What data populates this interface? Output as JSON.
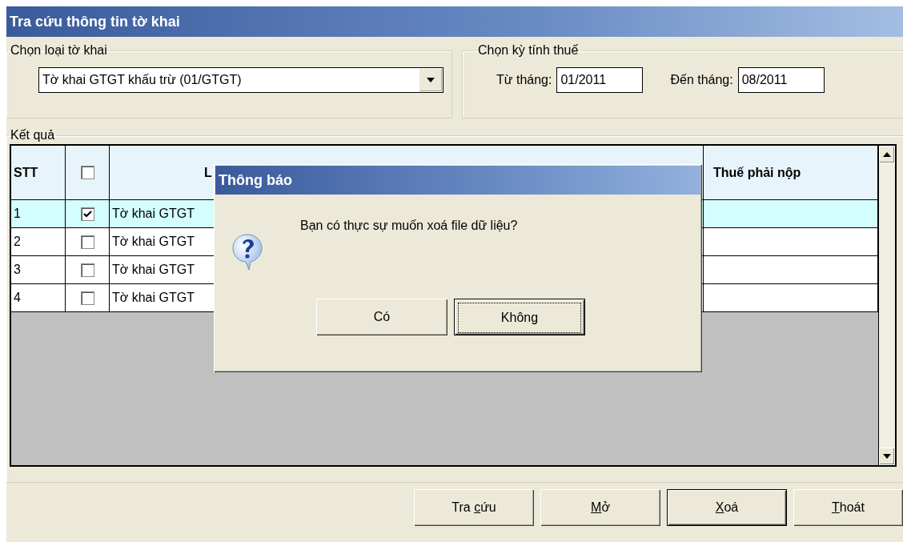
{
  "window": {
    "title": "Tra cứu thông tin tờ khai"
  },
  "declaration_type": {
    "legend": "Chọn loại tờ khai",
    "value": "Tờ khai GTGT khấu trừ (01/GTGT)"
  },
  "tax_period": {
    "legend": "Chọn kỳ tính thuế",
    "from_label": "Từ tháng:",
    "from_value": "01/2011",
    "to_label": "Đến tháng:",
    "to_value": "08/2011"
  },
  "results": {
    "legend": "Kết quả",
    "columns": [
      "STT",
      "L",
      "Thuế phải nộp"
    ],
    "header_checked": false,
    "rows": [
      {
        "stt": "1",
        "checked": true,
        "selected": true,
        "type": "Tờ khai GTGT"
      },
      {
        "stt": "2",
        "checked": false,
        "selected": false,
        "type": "Tờ khai GTGT"
      },
      {
        "stt": "3",
        "checked": false,
        "selected": false,
        "type": "Tờ khai GTGT"
      },
      {
        "stt": "4",
        "checked": false,
        "selected": false,
        "type": "Tờ khai GTGT"
      }
    ]
  },
  "buttons": [
    {
      "before": "Tra ",
      "mnemonic": "c",
      "after": "ứu",
      "default": false
    },
    {
      "mnemonic": "M",
      "after": "ở",
      "default": false
    },
    {
      "mnemonic": "X",
      "after": "oá",
      "default": true
    },
    {
      "mnemonic": "T",
      "after": "hoát",
      "default": false
    }
  ],
  "dialog": {
    "title": "Thông báo",
    "message": "Bạn có thực sự muốn xoá file dữ liệu?",
    "buttons": [
      {
        "label": "Có",
        "focused": false
      },
      {
        "label": "Không",
        "focused": true
      }
    ]
  }
}
